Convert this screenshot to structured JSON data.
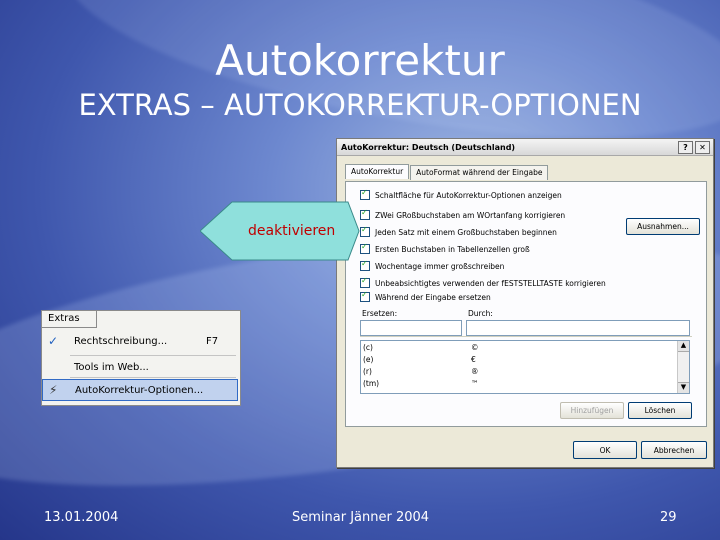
{
  "slide": {
    "title": "Autokorrektur",
    "subtitle": "EXTRAS – AUTOKORREKTUR-OPTIONEN",
    "callout": "deaktivieren",
    "footer": {
      "date": "13.01.2004",
      "event": "Seminar Jänner 2004",
      "page": "29"
    }
  },
  "dialog": {
    "title": "AutoKorrektur: Deutsch (Deutschland)",
    "help_btn": "?",
    "close_btn": "✕",
    "tabs": [
      "AutoKorrektur",
      "AutoFormat während der Eingabe"
    ],
    "options": [
      "Schaltfläche für AutoKorrektur-Optionen anzeigen",
      "ZWei GRoßbuchstaben am WOrtanfang korrigieren",
      "Jeden Satz mit einem Großbuchstaben beginnen",
      "Ersten Buchstaben in Tabellenzellen groß",
      "Wochentage immer großschreiben",
      "Unbeabsichtigtes verwenden der fESTSTELLTASTE korrigieren",
      "Während der Eingabe ersetzen"
    ],
    "exceptions_btn": "Ausnahmen...",
    "replace_label": "Ersetzen:",
    "with_label": "Durch:",
    "entries": [
      {
        "from": "(c)",
        "to": "©"
      },
      {
        "from": "(e)",
        "to": "€"
      },
      {
        "from": "(r)",
        "to": "®"
      },
      {
        "from": "(tm)",
        "to": "™"
      }
    ],
    "add_btn": "Hinzufügen",
    "delete_btn": "Löschen",
    "ok_btn": "OK",
    "cancel_btn": "Abbrechen"
  },
  "menu": {
    "header": "Extras",
    "items": [
      {
        "label": "Rechtschreibung...",
        "shortcut": "F7",
        "icon": "spellcheck-icon"
      },
      {
        "label": "Tools im Web...",
        "shortcut": "",
        "icon": ""
      },
      {
        "label": "AutoKorrektur-Optionen...",
        "shortcut": "",
        "icon": "autocorrect-icon"
      }
    ]
  }
}
